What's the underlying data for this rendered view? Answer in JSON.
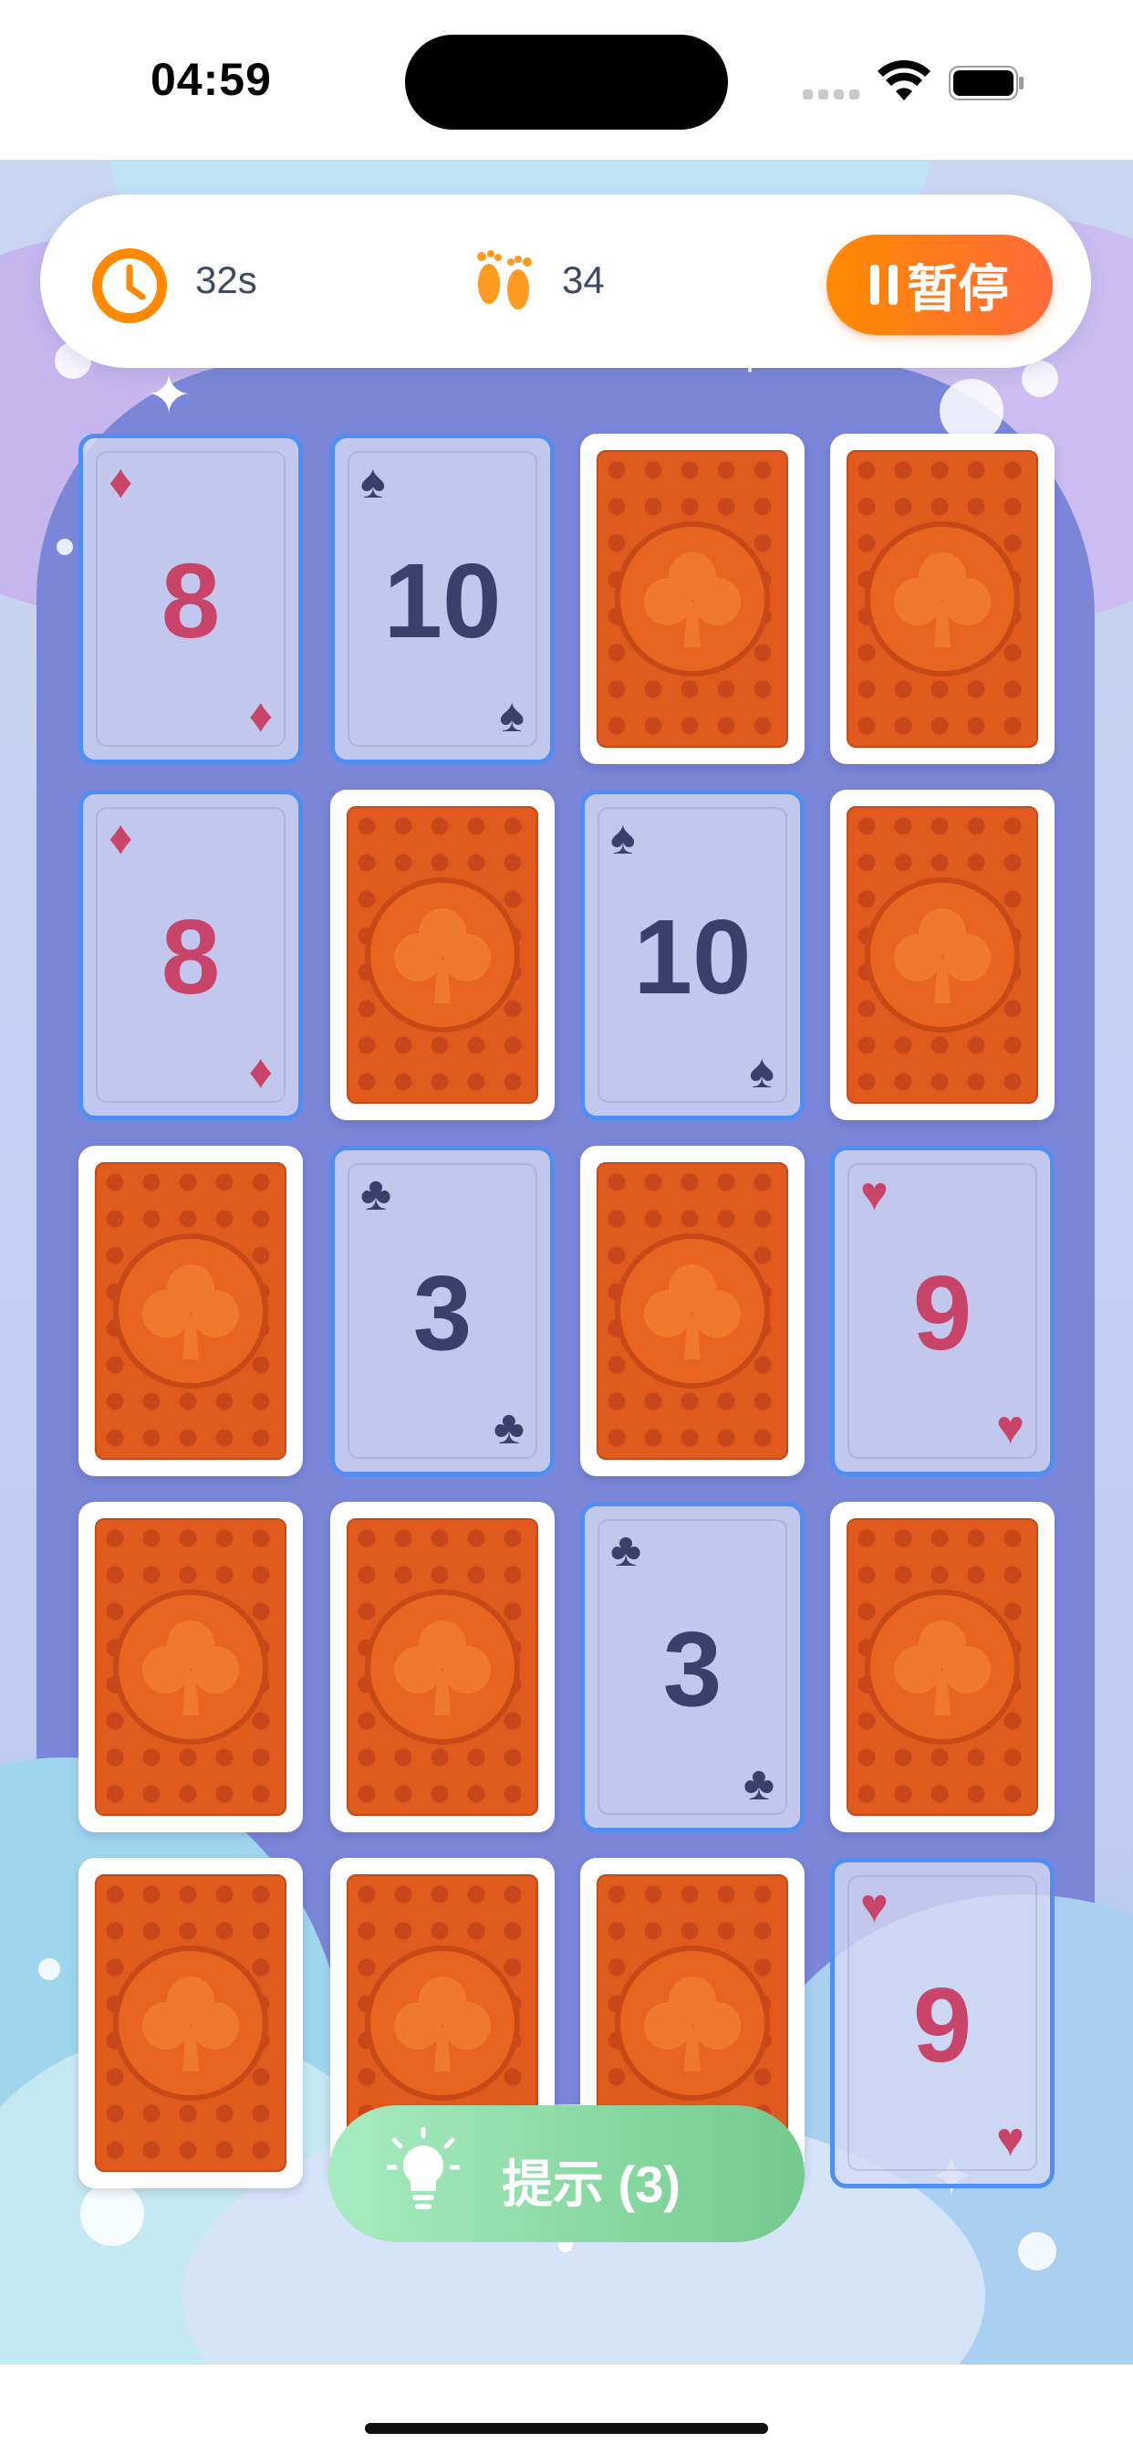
{
  "status_bar": {
    "time": "04:59"
  },
  "hud": {
    "timer": "32s",
    "steps": "34",
    "pause_label": "暂停",
    "icons": {
      "timer": "clock-icon",
      "steps": "footsteps-icon",
      "pause": "pause-icon"
    },
    "colors": {
      "accent": "#ff8a00"
    }
  },
  "cards": [
    {
      "state": "face",
      "rank": "8",
      "suit": "♦",
      "color": "red"
    },
    {
      "state": "face",
      "rank": "10",
      "suit": "♠",
      "color": "dark"
    },
    {
      "state": "back"
    },
    {
      "state": "back"
    },
    {
      "state": "face",
      "rank": "8",
      "suit": "♦",
      "color": "red"
    },
    {
      "state": "back"
    },
    {
      "state": "face",
      "rank": "10",
      "suit": "♠",
      "color": "dark"
    },
    {
      "state": "back"
    },
    {
      "state": "back"
    },
    {
      "state": "face",
      "rank": "3",
      "suit": "♣",
      "color": "dark"
    },
    {
      "state": "back"
    },
    {
      "state": "face",
      "rank": "9",
      "suit": "♥",
      "color": "red"
    },
    {
      "state": "back"
    },
    {
      "state": "back"
    },
    {
      "state": "face",
      "rank": "3",
      "suit": "♣",
      "color": "dark"
    },
    {
      "state": "back"
    },
    {
      "state": "back"
    },
    {
      "state": "back"
    },
    {
      "state": "back"
    },
    {
      "state": "face",
      "rank": "9",
      "suit": "♥",
      "color": "red"
    }
  ],
  "hint": {
    "label": "提示 (3)",
    "icon": "lightbulb-icon"
  }
}
